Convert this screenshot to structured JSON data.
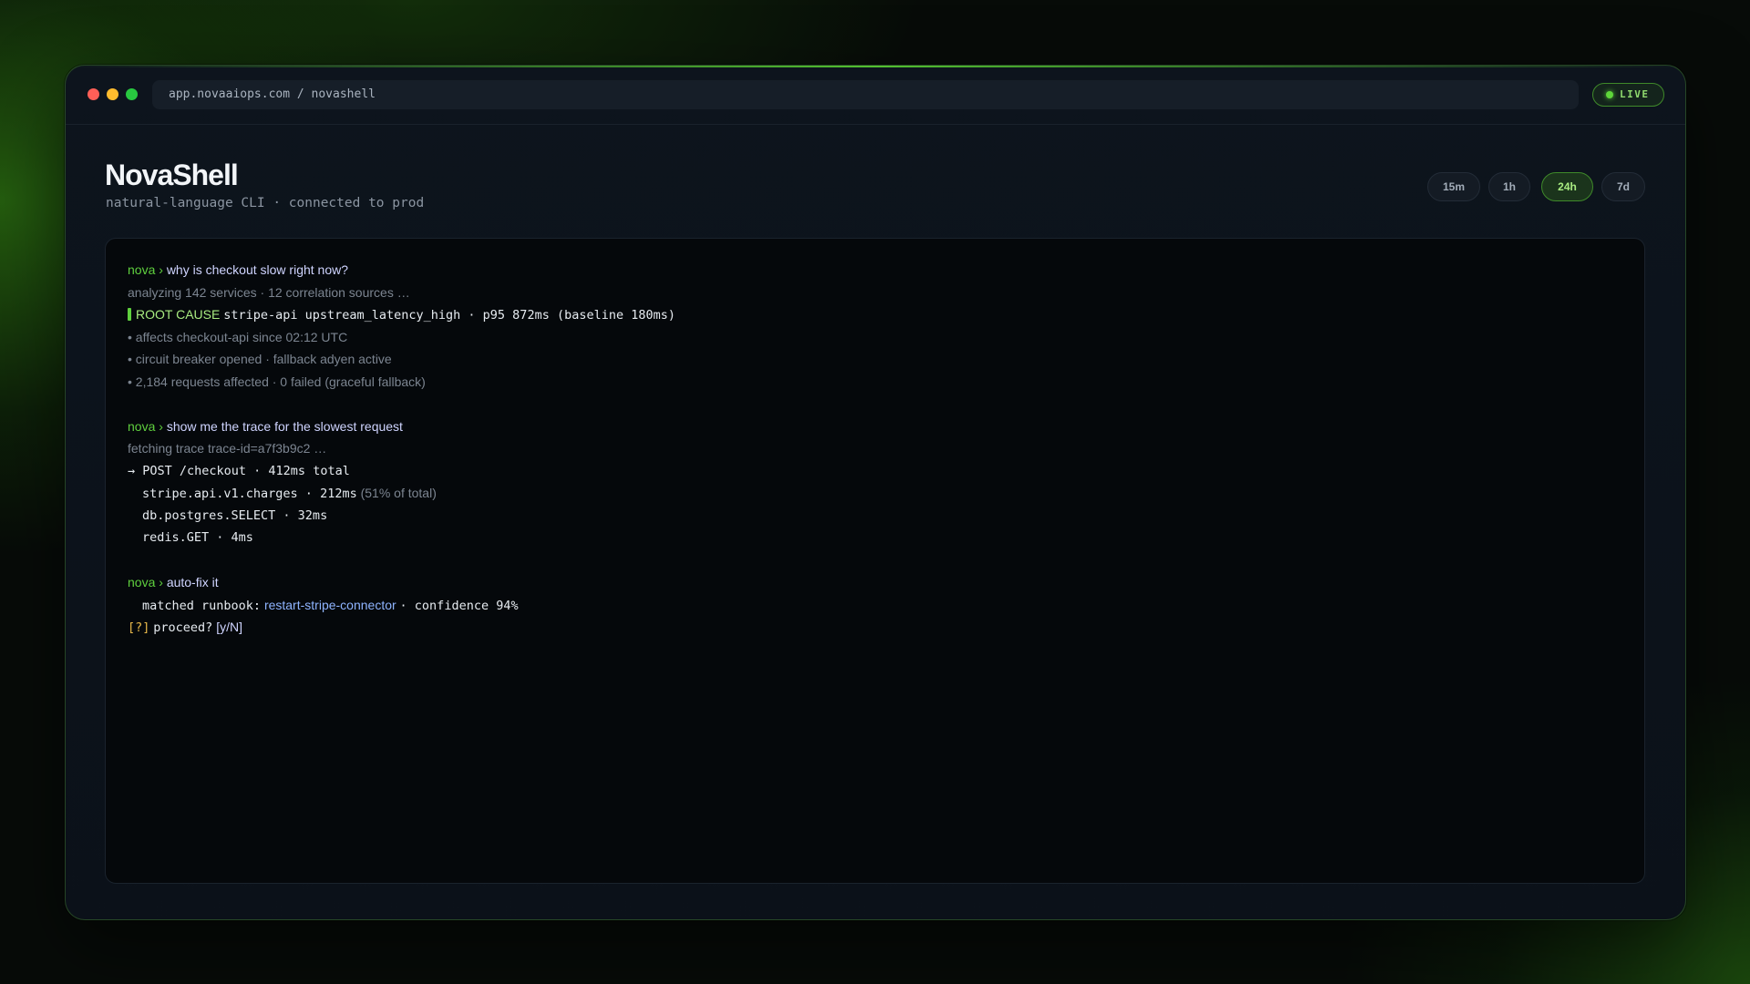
{
  "window": {
    "url": "app.novaaiops.com / novashell",
    "live_label": "LIVE"
  },
  "header": {
    "title": "NovaShell",
    "subtitle": "natural-language CLI · connected to prod"
  },
  "time_ranges": {
    "options": [
      "15m",
      "1h",
      "24h",
      "7d"
    ],
    "selected": "24h"
  },
  "terminal": {
    "prompt": "nova ›",
    "q1": {
      "query": "why is checkout slow right now?",
      "analyzing": "analyzing 142 services · 12 correlation sources …",
      "root_cause_label": "ROOT CAUSE",
      "root_cause_detail": "stripe-api upstream_latency_high · p95 872ms (baseline 180ms)",
      "bullets": [
        "• affects checkout-api since 02:12 UTC",
        "• circuit breaker opened · fallback adyen active",
        "• 2,184 requests affected · 0 failed (graceful fallback)"
      ]
    },
    "q2": {
      "query": "show me the trace for the slowest request",
      "fetching": "fetching trace trace-id=a7f3b9c2 …",
      "trace_root": "→ POST /checkout · 412ms total",
      "span1": "stripe.api.v1.charges · 212ms",
      "span1_note": "(51% of total)",
      "span2": "db.postgres.SELECT · 32ms",
      "span3": "redis.GET · 4ms"
    },
    "q3": {
      "query": "auto-fix it",
      "matched_prefix": "matched runbook:",
      "runbook": "restart-stripe-connector",
      "confidence": "· confidence 94%",
      "confirm_tag": "[?]",
      "confirm_text": "proceed?",
      "confirm_options": "[y/N]"
    }
  },
  "colors": {
    "accent": "#5fcf3e",
    "background": "#05080b",
    "link": "#8fb4ff",
    "warning": "#e8b84a"
  }
}
